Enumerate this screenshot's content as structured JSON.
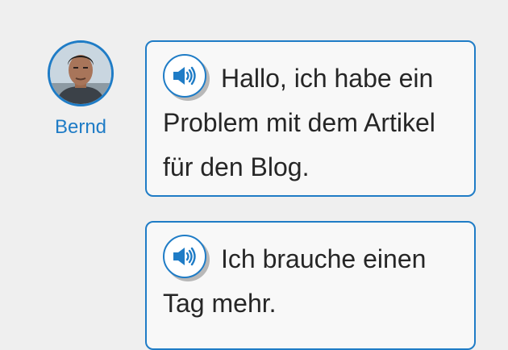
{
  "speaker": {
    "name": "Bernd",
    "avatar_icon": "portrait-photo",
    "accent_color": "#1f7cc6"
  },
  "messages": [
    {
      "text": "Hallo, ich habe ein Problem mit dem Artikel für den Blog.",
      "audio_icon": "speaker-icon"
    },
    {
      "text": "Ich brauche einen Tag mehr.",
      "audio_icon": "speaker-icon"
    }
  ]
}
